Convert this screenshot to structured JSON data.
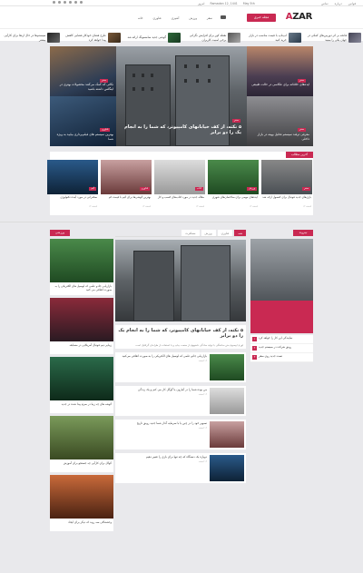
{
  "topbar": {
    "links": [
      "تماس",
      "درباره",
      "قوانین"
    ],
    "dateinfo": [
      "امروز",
      "Ramadan 12, 1441",
      "May 5th"
    ]
  },
  "header": {
    "logo_prefix": "A",
    "logo_rest": "ZAR",
    "badge": "مجله خبری",
    "nav": [
      "خانه",
      "فناوری",
      "آشپزی",
      "ورزش",
      "سفر"
    ]
  },
  "ticker": [
    "فاتحه بر اثر دوربین‌های کمکی در جهان یکی را ببینید",
    "لپ‌تاپ با قیمت مناسب در بازار خرید کنید",
    "نقطه کور برای افزایش نگرانی برخی امنیت کاربران",
    "گوشی جدید سامسونگ ارائه شد",
    "طرح فضای خودکار فضایی کاهش پیدا خواهد کرد",
    "سیستم‌ها در حال ارتقا برای کارآیی بیشتر"
  ],
  "feature": {
    "main_title": "۵ نکته، از کف خیابانهای کامپیوتر، که شما را به انجام یک را دو برابر",
    "left_top": "نکاتی که کمک می‌کنند محصولات بهتری در اینگلس داشته باشید",
    "left_bottom": "بهترین سیستم های فیلم‌برداری بیایید به ویژه شما",
    "right_top": "ایده‌های خلاقانه برای عکاسی در حالت طبیعی",
    "right_bottom": "معرفی ترفند سیستم تحلیل بهینه در بازار داخلی"
  },
  "strip": {
    "head": "آخرین مطالب",
    "cards": [
      {
        "title": "بازی‌های جدید فوتبال برای کنسول ارائه شد",
        "meta": "۱۲ اسفند"
      },
      {
        "title": "ایده‌های مهمی برای ساختمان‌های شهری",
        "meta": "۱۲ اسفند"
      },
      {
        "title": "مقاله جدید در مورد کتاب‌های کسب و کار",
        "meta": "۱۲ اسفند"
      },
      {
        "title": "بهترین گوشی‌ها برای گیم با قیمت کم",
        "meta": "۱۲ اسفند"
      },
      {
        "title": "سخنرانی در مورد آینده تکنولوژی",
        "meta": "۱۲ اسفند"
      }
    ]
  },
  "main": {
    "tabs": [
      "همه",
      "فناوری",
      "ورزش",
      "مسافرت"
    ],
    "col_left_head": "ورزشی",
    "col_right_head": "تیتروند",
    "big_title": "۵ نکته، از کف خیابانهای کامپیوتر، که شما را به انجام یک را دو برابر",
    "big_excerpt": "لورم ایپسوم متن ساختگی با تولید سادگی نامفهوم از صنعت چاپ و با استفاده از طراحان گرافیک است",
    "rows": [
      {
        "title": "بازاریابی جادو علمی که لوسیل های الکتریکی را به صورت اتفاقی می‌کنید",
        "meta": "۱۲ اسفند"
      },
      {
        "title": "من بوده شما را در آمارون یا گوگل کار می کنم و یک زندگی",
        "meta": "۱۲ اسفند"
      },
      {
        "title": "تصویر خود را در چین یا با سرمایه گذار شما جدید رونق تاریخ",
        "meta": "۱۲ اسفند"
      },
      {
        "title": "دوپاره یک دستگاه که چه تنها برای بازی را تغییر دهیم",
        "meta": "۱۲ اسفند"
      }
    ],
    "left_cards": [
      "بازاریابی جادو علمی که لوسیل های الکتریکی را به صورت اتفاقی می کنید",
      "زیبایی تیم فوتبال آمریکایی در مسابقه",
      "گوشه های چه زیبا در سرم پیدا شده در جدید",
      "گوگل برای کارآیی چه جستجو برای آموزش",
      "وحشتناکی سه روند که دیگر برای ایجاد"
    ],
    "right_list": [
      "نمایندگی این کار را خواهد کرد",
      "رونق شرکت در سیستم جدید",
      "تست جدید روی سفر"
    ]
  },
  "colors": {
    "accent": "#c92952",
    "dark": "#222222"
  }
}
